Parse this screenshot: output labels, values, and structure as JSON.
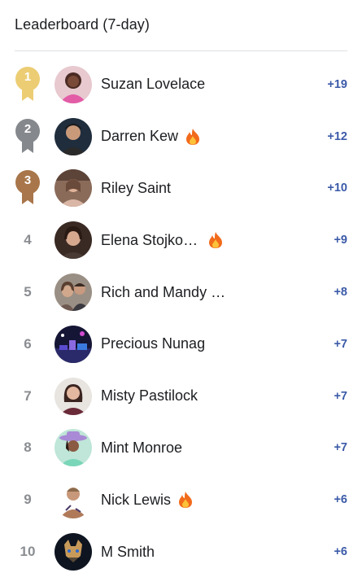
{
  "header": {
    "title": "Leaderboard (7-day)"
  },
  "colors": {
    "gold": "#eccd74",
    "silver": "#85888c",
    "bronze": "#a8764a",
    "score": "#3b5aa8",
    "rank": "#8a8d91"
  },
  "leaderboard": {
    "entries": [
      {
        "rank": "1",
        "name": "Suzan Lovelace",
        "score": "+19",
        "medal": "gold",
        "streak": false
      },
      {
        "rank": "2",
        "name": "Darren Kew",
        "score": "+12",
        "medal": "silver",
        "streak": true
      },
      {
        "rank": "3",
        "name": "Riley Saint",
        "score": "+10",
        "medal": "bronze",
        "streak": false
      },
      {
        "rank": "4",
        "name": "Elena Stojko…",
        "score": "+9",
        "medal": "",
        "streak": true
      },
      {
        "rank": "5",
        "name": "Rich and Mandy …",
        "score": "+8",
        "medal": "",
        "streak": false
      },
      {
        "rank": "6",
        "name": "Precious Nunag",
        "score": "+7",
        "medal": "",
        "streak": false
      },
      {
        "rank": "7",
        "name": "Misty Pastilock",
        "score": "+7",
        "medal": "",
        "streak": false
      },
      {
        "rank": "8",
        "name": "Mint Monroe",
        "score": "+7",
        "medal": "",
        "streak": false
      },
      {
        "rank": "9",
        "name": "Nick Lewis",
        "score": "+6",
        "medal": "",
        "streak": true
      },
      {
        "rank": "10",
        "name": "M Smith",
        "score": "+6",
        "medal": "",
        "streak": false
      }
    ]
  }
}
